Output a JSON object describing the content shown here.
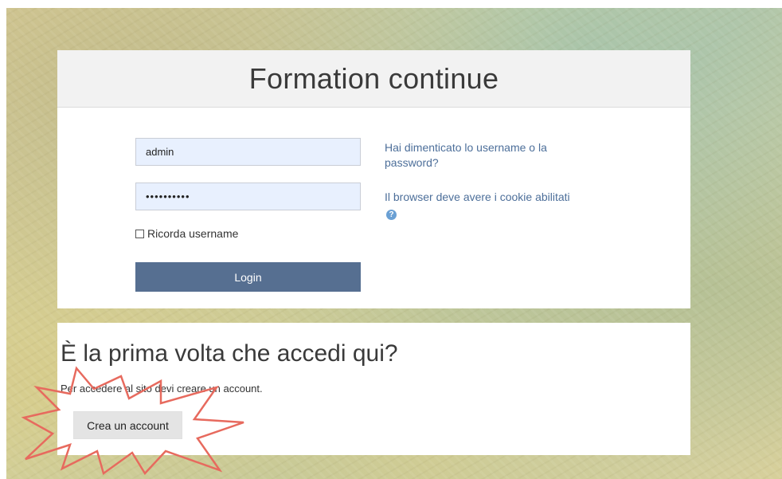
{
  "site": {
    "title": "Formation continue"
  },
  "login": {
    "username_value": "admin",
    "password_value": "••••••••••",
    "remember_label": "Ricorda username",
    "login_button_label": "Login",
    "forgot_link": "Hai dimenticato lo username o la password?",
    "cookies_note": "Il browser deve avere i cookie abilitati",
    "help_icon": "question-circle-icon"
  },
  "signup": {
    "heading": "È la prima volta che accedi qui?",
    "text": "Per accedere al sito devi creare un account.",
    "button_label": "Crea un account"
  },
  "annotation": {
    "shape": "starburst-highlight",
    "color": "#e76a5e"
  },
  "colors": {
    "primary": "#566f91",
    "link": "#4d6f9a",
    "field_bg": "#e8f0fe"
  }
}
